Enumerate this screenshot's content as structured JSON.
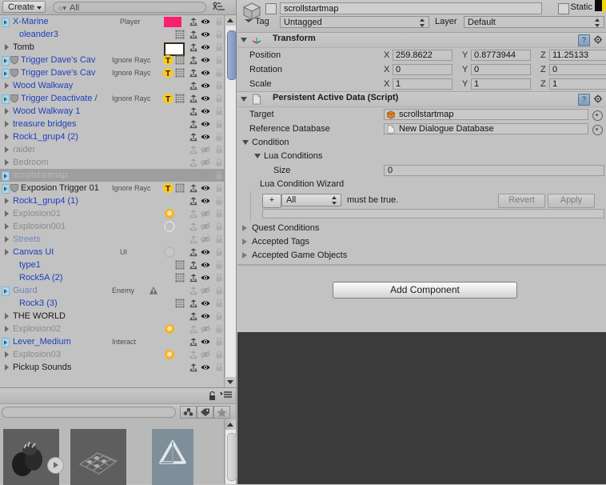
{
  "hierarchy": {
    "create_label": "Create",
    "search_placeholder": "All",
    "search_value": "",
    "search_icon": "search-icon",
    "sort_icon": "sort-alphabetical-icon",
    "items": [
      {
        "name": "X-Marine",
        "tag": "Player",
        "indent": 16,
        "color": "blue",
        "arrow": "prefab",
        "color_swatch": "#f9206e",
        "mesh": false,
        "static": true,
        "eye": "on",
        "lock": true
      },
      {
        "name": "oleander3",
        "tag": "",
        "indent": 24,
        "color": "blue",
        "arrow": "none",
        "mesh": true,
        "static": true,
        "eye": "on",
        "lock": true
      },
      {
        "name": "Tomb",
        "tag": "",
        "indent": 16,
        "color": "black",
        "arrow": "plain",
        "color_swatch": "#ffffff",
        "mesh": false,
        "static": true,
        "eye": "on",
        "lock": true
      },
      {
        "name": "Trigger Dave's Cav",
        "tag": "Ignore Rayc",
        "indent": 16,
        "color": "blue",
        "arrow": "prefab",
        "icon": "shield",
        "badge": "T",
        "mesh": true,
        "static": true,
        "eye": "on",
        "lock": true
      },
      {
        "name": "Trigger Dave's Cav",
        "tag": "Ignore Rayc",
        "indent": 16,
        "color": "blue",
        "arrow": "prefab",
        "icon": "shield",
        "badge": "T",
        "mesh": true,
        "static": true,
        "eye": "on",
        "lock": true
      },
      {
        "name": "Wood Walkway",
        "tag": "",
        "indent": 16,
        "color": "blue",
        "arrow": "plain",
        "mesh": false,
        "static": true,
        "eye": "on",
        "lock": true
      },
      {
        "name": "Trigger Deactivate /",
        "tag": "Ignore Rayc",
        "indent": 16,
        "color": "blue",
        "arrow": "prefab",
        "icon": "shield",
        "badge": "T",
        "mesh": true,
        "static": true,
        "eye": "on",
        "lock": true
      },
      {
        "name": "Wood Walkway 1",
        "tag": "",
        "indent": 16,
        "color": "blue",
        "arrow": "plain",
        "mesh": false,
        "static": true,
        "eye": "on",
        "lock": true
      },
      {
        "name": "treasure bridges",
        "tag": "",
        "indent": 16,
        "color": "blue",
        "arrow": "plain",
        "mesh": false,
        "static": true,
        "eye": "on",
        "lock": true
      },
      {
        "name": "Rock1_grup4 (2)",
        "tag": "",
        "indent": 16,
        "color": "blue",
        "arrow": "plain",
        "mesh": false,
        "static": true,
        "eye": "on",
        "lock": true
      },
      {
        "name": "raider",
        "tag": "",
        "indent": 16,
        "color": "gray",
        "arrow": "plain",
        "mesh": false,
        "static": true,
        "eye": "off",
        "lock": true
      },
      {
        "name": "Bedroom",
        "tag": "",
        "indent": 16,
        "color": "gray",
        "arrow": "plain",
        "mesh": false,
        "static": true,
        "eye": "off",
        "lock": true
      },
      {
        "name": "scrollstartmap",
        "tag": "",
        "indent": 16,
        "color": "selwhite",
        "arrow": "prefab",
        "selected": true,
        "mesh": false,
        "static": true,
        "eye": "off",
        "lock": true
      },
      {
        "name": "Exposion Trigger 01",
        "tag": "Ignore Rayc",
        "indent": 16,
        "color": "black",
        "arrow": "prefab",
        "icon": "shield",
        "badge": "T",
        "mesh": true,
        "static": true,
        "eye": "on",
        "lock": true
      },
      {
        "name": "Rock1_grup4 (1)",
        "tag": "",
        "indent": 16,
        "color": "blue",
        "arrow": "plain",
        "mesh": false,
        "static": true,
        "eye": "on",
        "lock": true
      },
      {
        "name": "Explosion01",
        "tag": "",
        "indent": 16,
        "color": "gray",
        "arrow": "plain",
        "color_swatch": "#f7b22a",
        "swatch_shape": "blob",
        "mesh": false,
        "static": true,
        "eye": "off",
        "lock": true
      },
      {
        "name": "Explosion001",
        "tag": "",
        "indent": 16,
        "color": "gray",
        "arrow": "plain",
        "color_swatch": "#d9d9d9",
        "swatch_shape": "blob-outline",
        "mesh": false,
        "static": true,
        "eye": "off",
        "lock": true
      },
      {
        "name": "Streets",
        "tag": "",
        "indent": 16,
        "color": "gblue",
        "arrow": "plain",
        "mesh": false,
        "static": true,
        "eye": "off",
        "lock": true
      },
      {
        "name": "Canvas UI",
        "tag": "UI",
        "indent": 16,
        "color": "blue",
        "arrow": "plain",
        "color_swatch": "#bfbfbf",
        "swatch_shape": "circle",
        "mesh": false,
        "static": true,
        "eye": "on",
        "lock": true
      },
      {
        "name": "type1",
        "tag": "",
        "indent": 24,
        "color": "blue",
        "arrow": "none",
        "mesh": true,
        "static": true,
        "eye": "on",
        "lock": true
      },
      {
        "name": "Rock5A (2)",
        "tag": "",
        "indent": 24,
        "color": "blue",
        "arrow": "none",
        "mesh": true,
        "static": true,
        "eye": "on",
        "lock": true
      },
      {
        "name": "Guard",
        "tag": "Enemy",
        "indent": 16,
        "color": "gblue",
        "arrow": "prefab",
        "icon": "warning",
        "mesh": false,
        "static": true,
        "eye": "off",
        "lock": true
      },
      {
        "name": "Rock3 (3)",
        "tag": "",
        "indent": 24,
        "color": "blue",
        "arrow": "none",
        "mesh": true,
        "static": true,
        "eye": "on",
        "lock": true
      },
      {
        "name": "THE WORLD",
        "tag": "",
        "indent": 16,
        "color": "black",
        "arrow": "plain",
        "mesh": false,
        "static": true,
        "eye": "on",
        "lock": true
      },
      {
        "name": "Explosion02",
        "tag": "",
        "indent": 16,
        "color": "gray",
        "arrow": "plain",
        "color_swatch": "#f7b22a",
        "swatch_shape": "blob",
        "mesh": false,
        "static": true,
        "eye": "off",
        "lock": true
      },
      {
        "name": "Lever_Medium",
        "tag": "Interact",
        "indent": 16,
        "color": "blue",
        "arrow": "prefab",
        "mesh": false,
        "static": true,
        "eye": "on",
        "lock": true
      },
      {
        "name": "Explosion03",
        "tag": "",
        "indent": 16,
        "color": "gray",
        "arrow": "plain",
        "color_swatch": "#f7b22a",
        "swatch_shape": "blob",
        "mesh": false,
        "static": true,
        "eye": "off",
        "lock": true
      },
      {
        "name": "Pickup Sounds",
        "tag": "",
        "indent": 16,
        "color": "black",
        "arrow": "plain",
        "mesh": false,
        "static": true,
        "eye": "on",
        "lock": true
      }
    ]
  },
  "project": {
    "lock_icon": "lock-icon",
    "menu_icon": "hamburger-menu-icon",
    "search_value": "",
    "filter_buttons": [
      "object-filter-icon",
      "label-filter-icon",
      "favorite-star-icon"
    ],
    "thumbnails": [
      "audio-asset-thumbnail",
      "mesh-asset-thumbnail",
      "unity-asset-thumbnail"
    ]
  },
  "inspector": {
    "object_icon": "gameobject-cube-icon",
    "enabled": false,
    "name_value": "scrollstartmap",
    "static_label": "Static",
    "static_checked": false,
    "tag_label": "Tag",
    "tag_value": "Untagged",
    "layer_label": "Layer",
    "layer_value": "Default",
    "transform": {
      "title": "Transform",
      "icon": "transform-axis-icon",
      "rows": [
        {
          "label": "Position",
          "x": "259.8622",
          "y": "0.8773944",
          "z": "11.25133"
        },
        {
          "label": "Rotation",
          "x": "0",
          "y": "0",
          "z": "0"
        },
        {
          "label": "Scale",
          "x": "1",
          "y": "1",
          "z": "1"
        }
      ],
      "axis_labels": {
        "x": "X",
        "y": "Y",
        "z": "Z"
      },
      "help_icon": "help-icon",
      "gear_icon": "gear-icon"
    },
    "script_component": {
      "title": "Persistent Active Data (Script)",
      "icon": "script-file-icon",
      "help_icon": "help-icon",
      "gear_icon": "gear-icon",
      "target_label": "Target",
      "target_value": "scrollstartmap",
      "refdb_label": "Reference Database",
      "refdb_value": "New Dialogue Database",
      "condition_label": "Condition",
      "lua_conditions_label": "Lua Conditions",
      "size_label": "Size",
      "size_value": "0",
      "wizard_label": "Lua Condition Wizard",
      "plus_label": "+",
      "all_value": "All",
      "must_be_true": "must be true.",
      "revert_label": "Revert",
      "apply_label": "Apply",
      "wizard_field_value": "",
      "quest_conditions_label": "Quest Conditions",
      "accepted_tags_label": "Accepted Tags",
      "accepted_game_objects_label": "Accepted Game Objects"
    },
    "add_component_label": "Add Component"
  }
}
